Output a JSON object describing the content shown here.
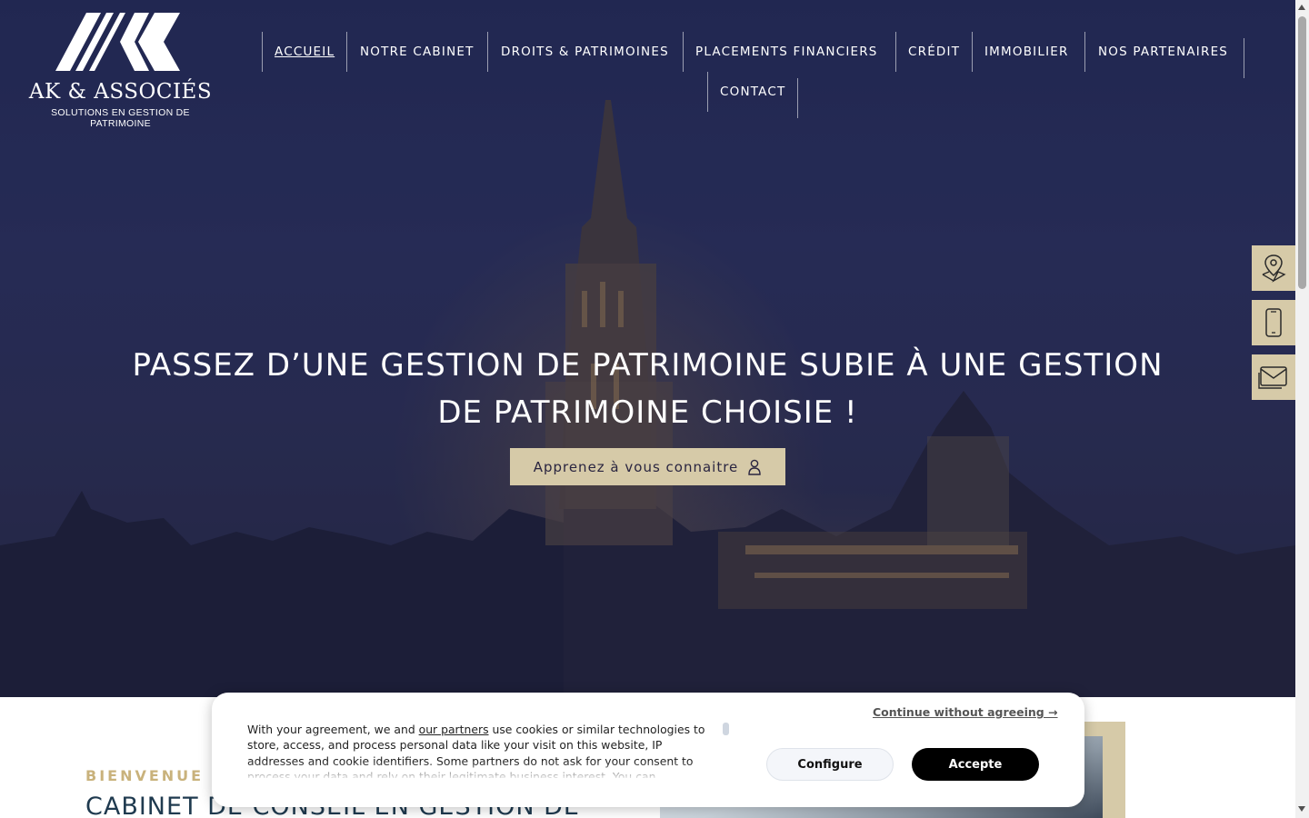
{
  "brand": {
    "name": "AK & ASSOCIÉS",
    "tagline": "SOLUTIONS EN GESTION DE PATRIMOINE"
  },
  "nav": {
    "items": [
      {
        "label": "ACCUEIL",
        "active": true
      },
      {
        "label": "NOTRE CABINET"
      },
      {
        "label": "DROITS & PATRIMOINES"
      },
      {
        "label": "PLACEMENTS FINANCIERS"
      },
      {
        "label": "CRÉDIT"
      },
      {
        "label": "IMMOBILIER"
      },
      {
        "label": "NOS PARTENAIRES"
      },
      {
        "label": "CONTACT"
      }
    ]
  },
  "hero": {
    "headline_line1": "PASSEZ D’UNE GESTION DE PATRIMOINE SUBIE À UNE GESTION",
    "headline_line2": "DE PATRIMOINE CHOISIE !",
    "cta_label": "Apprenez à vous connaitre",
    "cta_icon": "user-icon"
  },
  "side_tabs": [
    {
      "icon": "map-pin-icon"
    },
    {
      "icon": "phone-icon"
    },
    {
      "icon": "mail-icon"
    }
  ],
  "welcome": {
    "kicker": "BIENVENUE !",
    "title": "CABINET DE CONSEIL EN GESTION DE"
  },
  "cookie": {
    "text_before_link": "With your agreement, we and ",
    "link": "our partners",
    "text_after_link": " use cookies or similar technologies to store, access, and process personal data like your visit on this website, IP addresses and cookie identifiers. Some partners do not ask for your consent to process your data and rely on their legitimate business interest. You can",
    "continue_label": "Continue without agreeing →",
    "configure_label": "Configure",
    "accept_label": "Accepte"
  },
  "colors": {
    "accent": "#d6caa8",
    "gold_text": "#c9b27c",
    "navy": "#1f3a4f",
    "hero_bg": "#2b3058"
  }
}
